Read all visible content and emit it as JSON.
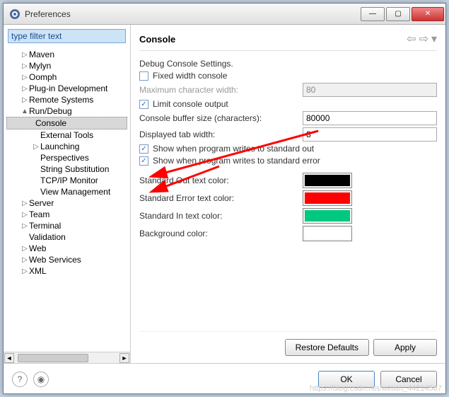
{
  "window": {
    "title": "Preferences"
  },
  "sidebar": {
    "filter_placeholder": "type filter text",
    "items": [
      {
        "label": "Maven",
        "exp": "▷"
      },
      {
        "label": "Mylyn",
        "exp": "▷"
      },
      {
        "label": "Oomph",
        "exp": "▷"
      },
      {
        "label": "Plug-in Development",
        "exp": "▷"
      },
      {
        "label": "Remote Systems",
        "exp": "▷"
      },
      {
        "label": "Run/Debug",
        "exp": "▲"
      },
      {
        "label": "Console",
        "selected": true
      },
      {
        "label": "External Tools"
      },
      {
        "label": "Launching",
        "exp": "▷"
      },
      {
        "label": "Perspectives"
      },
      {
        "label": "String Substitution"
      },
      {
        "label": "TCP/IP Monitor"
      },
      {
        "label": "View Management"
      },
      {
        "label": "Server",
        "exp": "▷"
      },
      {
        "label": "Team",
        "exp": "▷"
      },
      {
        "label": "Terminal",
        "exp": "▷"
      },
      {
        "label": "Validation"
      },
      {
        "label": "Web",
        "exp": "▷"
      },
      {
        "label": "Web Services",
        "exp": "▷"
      },
      {
        "label": "XML",
        "exp": "▷"
      }
    ]
  },
  "main": {
    "title": "Console",
    "settings_title": "Debug Console Settings.",
    "fixed_width": {
      "label": "Fixed width console",
      "checked": false
    },
    "max_char_width": {
      "label": "Maximum character width:",
      "value": "80",
      "disabled": true
    },
    "limit_output": {
      "label": "Limit console output",
      "checked": true
    },
    "buffer_size": {
      "label": "Console buffer size (characters):",
      "value": "80000"
    },
    "tab_width": {
      "label": "Displayed tab width:",
      "value": "8"
    },
    "show_stdout": {
      "label": "Show when program writes to standard out",
      "checked": true
    },
    "show_stderr": {
      "label": "Show when program writes to standard error",
      "checked": true
    },
    "color_stdout": {
      "label": "Standard Out text color:",
      "color": "#000000"
    },
    "color_stderr": {
      "label": "Standard Error text color:",
      "color": "#ff0000"
    },
    "color_stdin": {
      "label": "Standard In text color:",
      "color": "#00c880"
    },
    "color_bg": {
      "label": "Background color:",
      "color": "#ffffff"
    },
    "restore_defaults": "Restore Defaults",
    "apply": "Apply"
  },
  "footer": {
    "ok": "OK",
    "cancel": "Cancel"
  },
  "watermark": "https://blog.csdn.net/weixin_44214567"
}
